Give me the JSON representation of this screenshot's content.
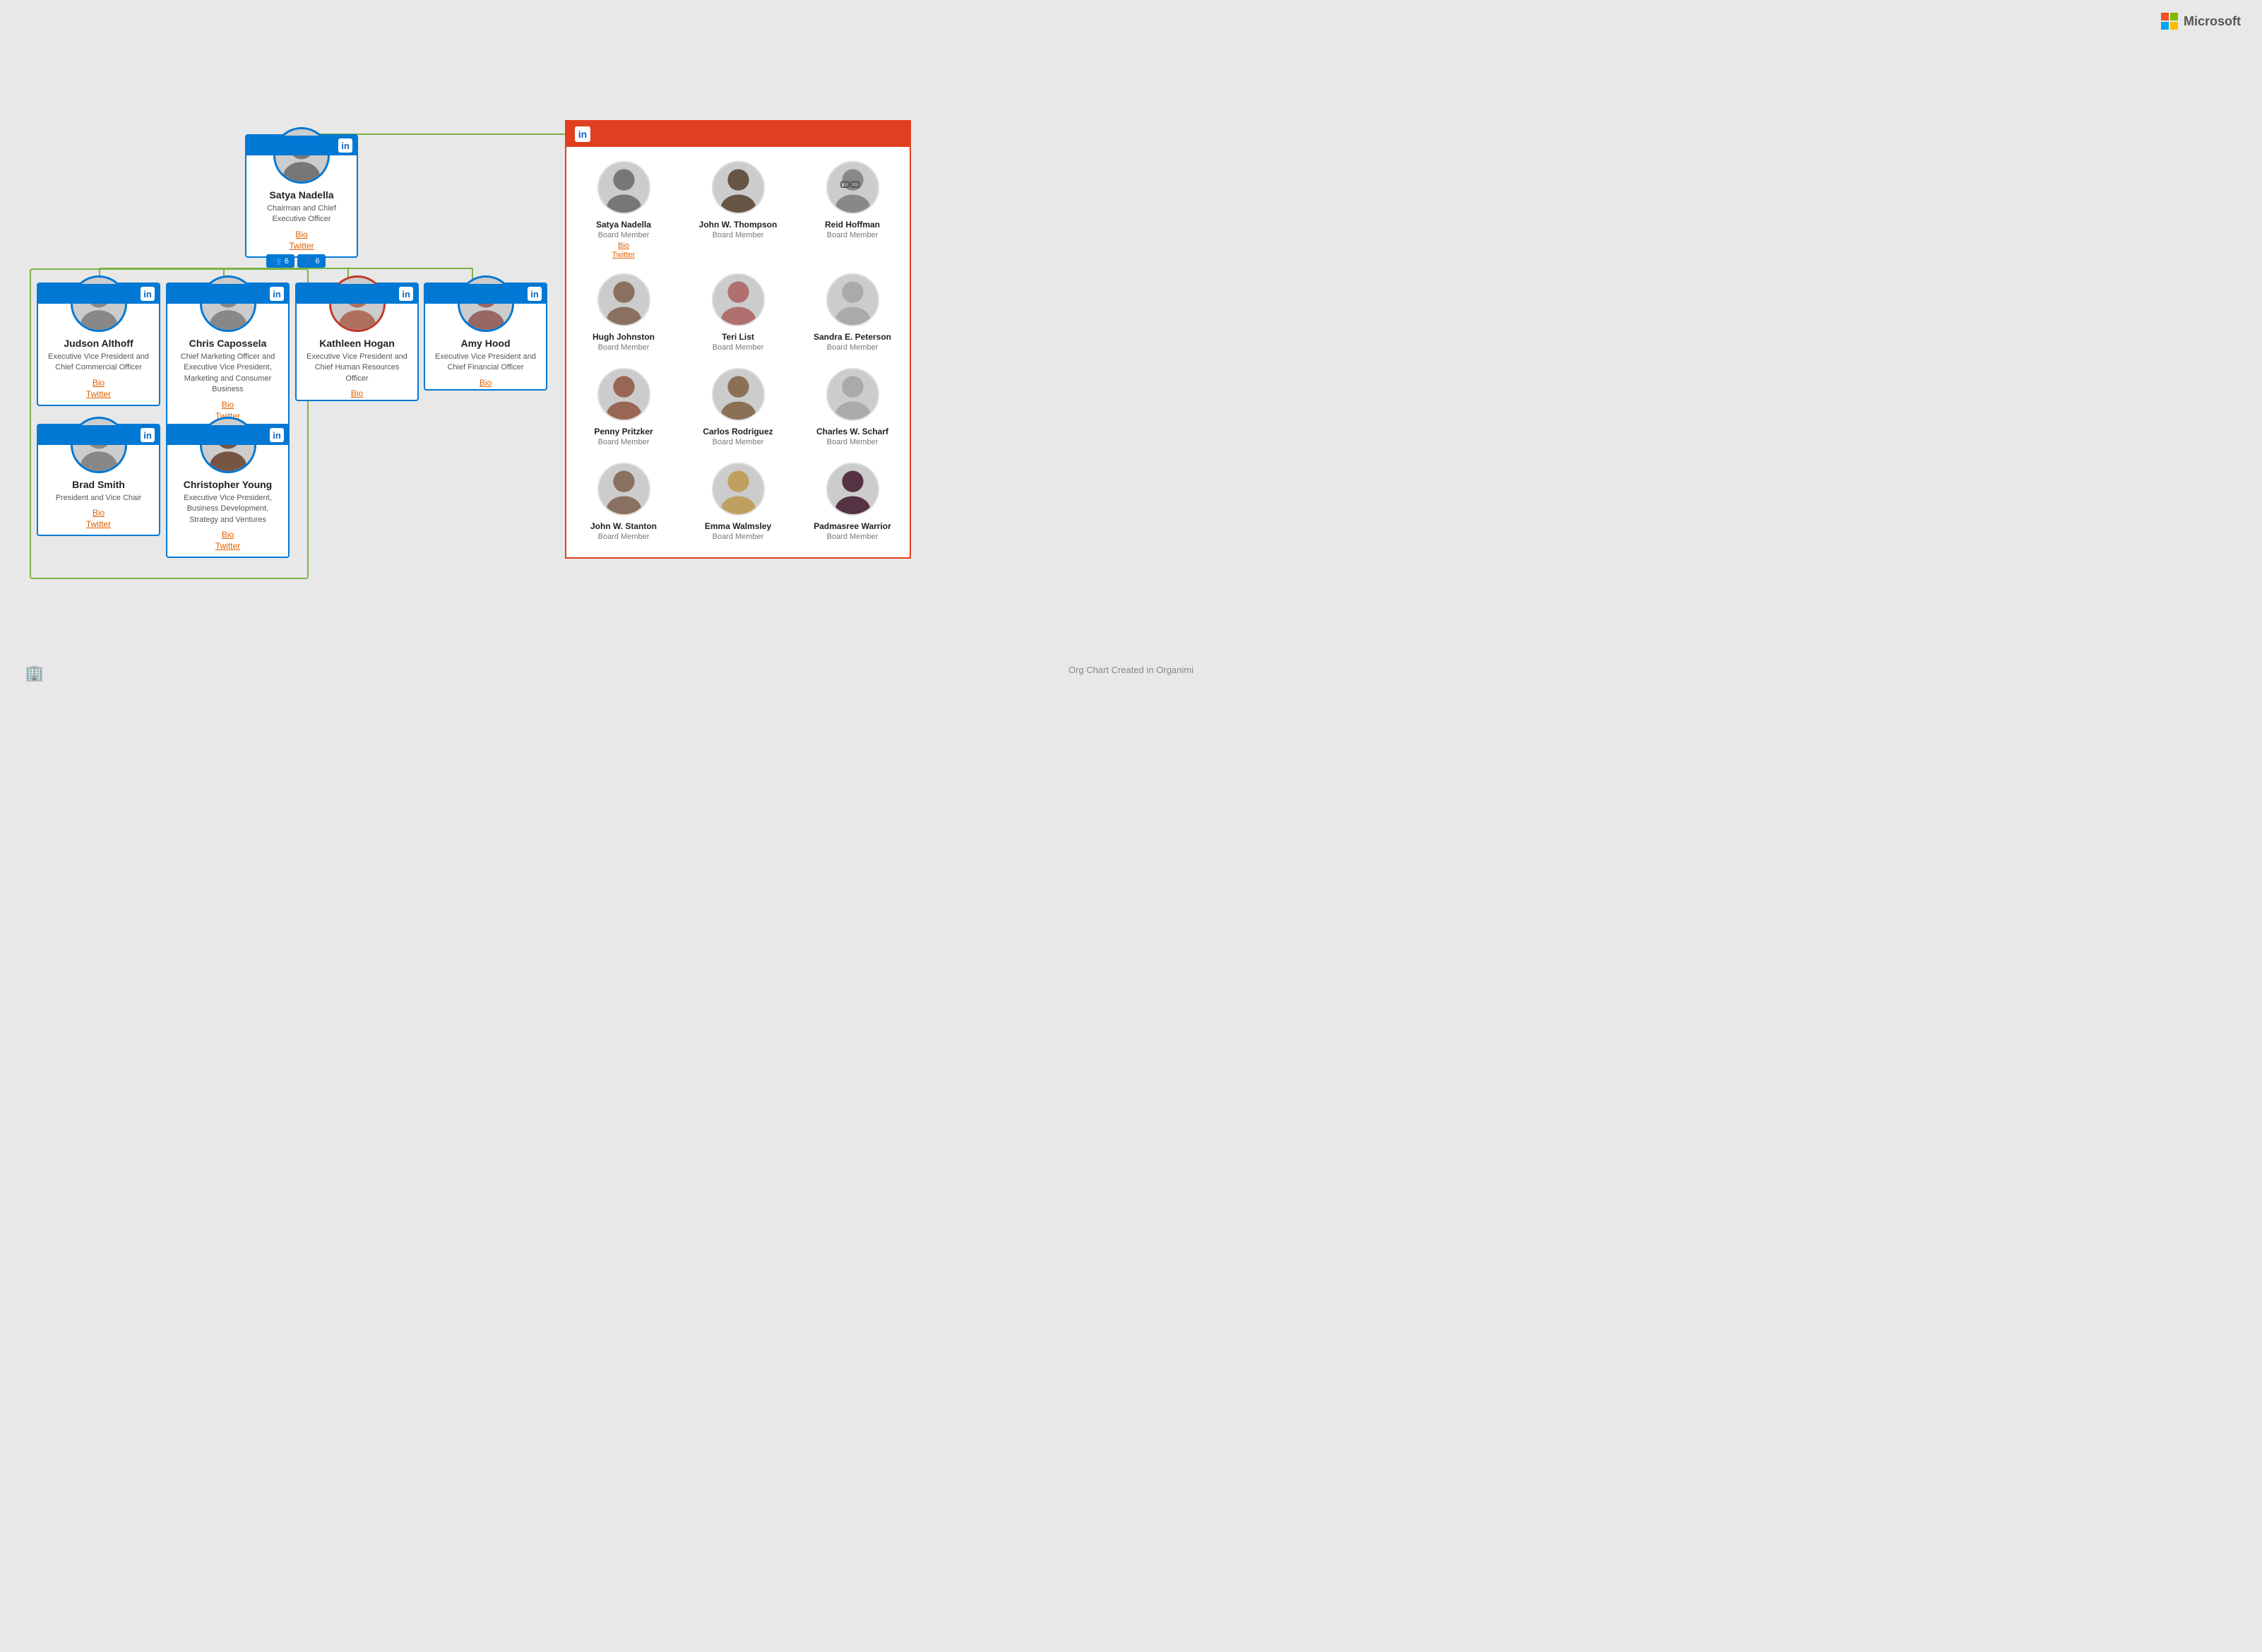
{
  "header": {
    "brand": "Microsoft",
    "logo_colors": [
      "#f25022",
      "#7fba00",
      "#00a4ef",
      "#ffb900"
    ]
  },
  "root": {
    "name": "Satya Nadella",
    "title": "Chairman and Chief Executive Officer",
    "bio_label": "Bio",
    "twitter_label": "Twitter",
    "badge_group": "6",
    "badge_person": "6"
  },
  "subordinates_row1": [
    {
      "name": "Judson Althoff",
      "title": "Executive Vice President and Chief Commercial Officer",
      "bio_label": "Bio",
      "twitter_label": "Twitter"
    },
    {
      "name": "Chris Capossela",
      "title": "Chief Marketing Officer and Executive Vice President, Marketing and Consumer Business",
      "bio_label": "Bio",
      "twitter_label": "Twitter"
    },
    {
      "name": "Kathleen Hogan",
      "title": "Executive Vice President and Chief Human Resources Officer",
      "bio_label": "Bio"
    },
    {
      "name": "Amy Hood",
      "title": "Executive Vice President and Chief Financial Officer",
      "bio_label": "Bio"
    }
  ],
  "subordinates_row2": [
    {
      "name": "Brad Smith",
      "title": "President and Vice Chair",
      "bio_label": "Bio",
      "twitter_label": "Twitter"
    },
    {
      "name": "Christopher Young",
      "title": "Executive Vice President, Business Development, Strategy and Ventures",
      "bio_label": "Bio",
      "twitter_label": "Twitter"
    }
  ],
  "board": {
    "members": [
      {
        "name": "Satya Nadella",
        "role": "Board Member",
        "bio_label": "Bio",
        "twitter_label": "Twitter"
      },
      {
        "name": "John W. Thompson",
        "role": "Board Member"
      },
      {
        "name": "Reid Hoffman",
        "role": "Board Member"
      },
      {
        "name": "Hugh Johnston",
        "role": "Board Member"
      },
      {
        "name": "Teri List",
        "role": "Board Member"
      },
      {
        "name": "Sandra E. Peterson",
        "role": "Board Member"
      },
      {
        "name": "Penny Pritzker",
        "role": "Board Member"
      },
      {
        "name": "Carlos Rodriguez",
        "role": "Board Member"
      },
      {
        "name": "Charles W. Scharf",
        "role": "Board Member"
      },
      {
        "name": "John W. Stanton",
        "role": "Board Member"
      },
      {
        "name": "Emma Walmsley",
        "role": "Board Member"
      },
      {
        "name": "Padmasree Warrior",
        "role": "Board Member"
      }
    ]
  },
  "footer": {
    "text": "Org Chart Created in Organimi"
  }
}
